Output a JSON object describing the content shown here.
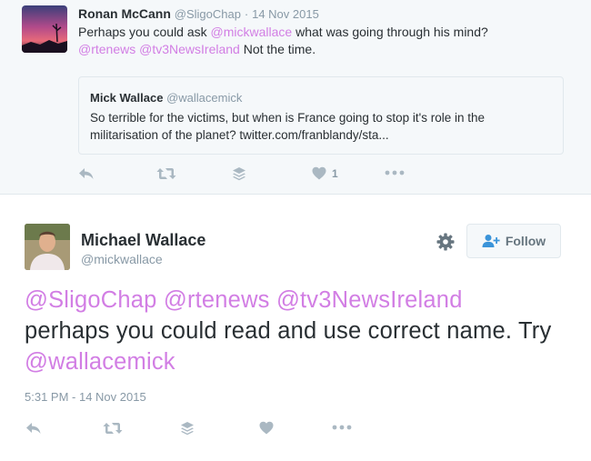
{
  "reply": {
    "name": "Ronan McCann",
    "handle": "@SligoChap",
    "separator": "·",
    "date": "14 Nov 2015",
    "text_1": "Perhaps you could ask ",
    "mention_1": "@mickwallace",
    "text_2": " what was going through his mind?",
    "mention_2": "@rtenews",
    "space": " ",
    "mention_3": "@tv3NewsIreland",
    "text_3": " Not the time.",
    "quote": {
      "name": "Mick Wallace",
      "handle": "@wallacemick",
      "text": "So terrible for the victims, but when is France going to stop it's role in the militarisation of the planet? twitter.com/franblandy/sta..."
    },
    "actions": {
      "like_count": "1"
    }
  },
  "tweet": {
    "name": "Michael Wallace",
    "handle": "@mickwallace",
    "follow_label": "Follow",
    "mention_1": "@SligoChap",
    "mention_2": "@rtenews",
    "mention_3": "@tv3NewsIreland",
    "text_1": "perhaps you could read and use correct name. Try ",
    "mention_4": "@wallacemick",
    "timestamp": "5:31 PM - 14 Nov 2015"
  },
  "colors": {
    "mention": "#d27ee4",
    "icon": "#aab8c2",
    "muted_text": "#8899a6",
    "reply_background": "#f5f8fa"
  },
  "icons": [
    "reply-icon",
    "retweet-icon",
    "buffer-icon",
    "like-icon",
    "more-icon",
    "gear-icon",
    "follow-person-icon"
  ]
}
